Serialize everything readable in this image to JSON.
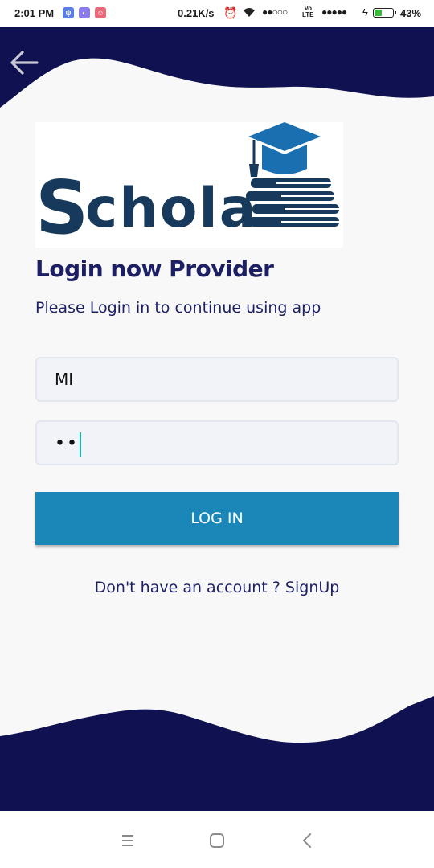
{
  "status_bar": {
    "time": "2:01 PM",
    "network_speed": "0.21K/s",
    "volte": "Vo LTE",
    "battery_percent": "43%",
    "battery_level": 0.43,
    "notification_icons": [
      "vpn-icon",
      "app-icon",
      "app-icon"
    ]
  },
  "header": {
    "back_icon": "arrow-left-icon"
  },
  "logo": {
    "text": "Scholar"
  },
  "login": {
    "title": "Login now Provider",
    "subtitle": "Please Login in to continue using app",
    "username_value": "MI",
    "password_mask": "••",
    "login_button": "LOG IN",
    "signup_prompt": "Don't have an account ?",
    "signup_link": "SignUp"
  },
  "nav_bar": {
    "icons": [
      "menu-icon",
      "home-icon",
      "back-icon"
    ]
  },
  "colors": {
    "navy": "#0f1151",
    "title_text": "#1c1f63",
    "button": "#1b86b8",
    "background": "#f8f8f8",
    "logo_blue": "#1a6fb0"
  }
}
